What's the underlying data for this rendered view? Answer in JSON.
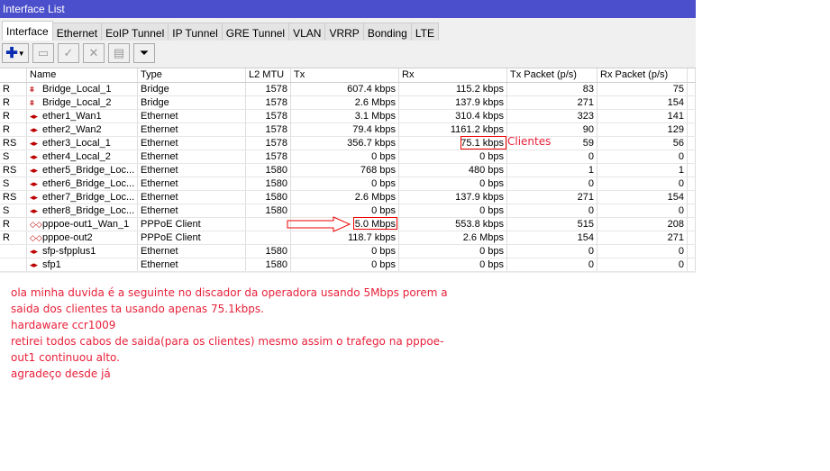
{
  "window": {
    "title": "Interface List"
  },
  "tabs": [
    "Interface",
    "Ethernet",
    "EoIP Tunnel",
    "IP Tunnel",
    "GRE Tunnel",
    "VLAN",
    "VRRP",
    "Bonding",
    "LTE"
  ],
  "columns": [
    "",
    "Name",
    "Type",
    "L2 MTU",
    "Tx",
    "Rx",
    "Tx Packet (p/s)",
    "Rx Packet (p/s)"
  ],
  "rows": [
    [
      "R",
      "Bridge_Local_1",
      "Bridge",
      "1578",
      "607.4 kbps",
      "115.2 kbps",
      "83",
      "75",
      "bridge"
    ],
    [
      "R",
      "Bridge_Local_2",
      "Bridge",
      "1578",
      "2.6 Mbps",
      "137.9 kbps",
      "271",
      "154",
      "bridge"
    ],
    [
      "R",
      "ether1_Wan1",
      "Ethernet",
      "1578",
      "3.1 Mbps",
      "310.4 kbps",
      "323",
      "141",
      "eth"
    ],
    [
      "R",
      "ether2_Wan2",
      "Ethernet",
      "1578",
      "79.4 kbps",
      "1161.2 kbps",
      "90",
      "129",
      "eth"
    ],
    [
      "RS",
      "ether3_Local_1",
      "Ethernet",
      "1578",
      "356.7 kbps",
      "75.1 kbps",
      "59",
      "56",
      "eth"
    ],
    [
      "S",
      "ether4_Local_2",
      "Ethernet",
      "1578",
      "0 bps",
      "0 bps",
      "0",
      "0",
      "eth"
    ],
    [
      "RS",
      "ether5_Bridge_Loc...",
      "Ethernet",
      "1580",
      "768 bps",
      "480 bps",
      "1",
      "1",
      "eth"
    ],
    [
      "S",
      "ether6_Bridge_Loc...",
      "Ethernet",
      "1580",
      "0 bps",
      "0 bps",
      "0",
      "0",
      "eth"
    ],
    [
      "RS",
      "ether7_Bridge_Loc...",
      "Ethernet",
      "1580",
      "2.6 Mbps",
      "137.9 kbps",
      "271",
      "154",
      "eth"
    ],
    [
      "S",
      "ether8_Bridge_Loc...",
      "Ethernet",
      "1580",
      "0 bps",
      "0 bps",
      "0",
      "0",
      "eth"
    ],
    [
      "R",
      "pppoe-out1_Wan_1",
      "PPPoE Client",
      "",
      "5.0 Mbps",
      "553.8 kbps",
      "515",
      "208",
      "ppp"
    ],
    [
      "R",
      "pppoe-out2",
      "PPPoE Client",
      "",
      "118.7 kbps",
      "2.6 Mbps",
      "154",
      "271",
      "ppp"
    ],
    [
      "",
      "sfp-sfpplus1",
      "Ethernet",
      "1580",
      "0 bps",
      "0 bps",
      "0",
      "0",
      "eth"
    ],
    [
      "",
      "sfp1",
      "Ethernet",
      "1580",
      "0 bps",
      "0 bps",
      "0",
      "0",
      "eth"
    ]
  ],
  "annotation": {
    "label": "Clientes"
  },
  "note": [
    "ola minha duvida é a seguinte no discador da operadora usando 5Mbps porem a",
    "saida dos clientes ta usando apenas 75.1kbps.",
    "hardaware ccr1009",
    "retirei todos cabos de saida(para os clientes) mesmo assim o trafego na pppoe-",
    "out1  continuou alto.",
    "agradeço desde já"
  ]
}
